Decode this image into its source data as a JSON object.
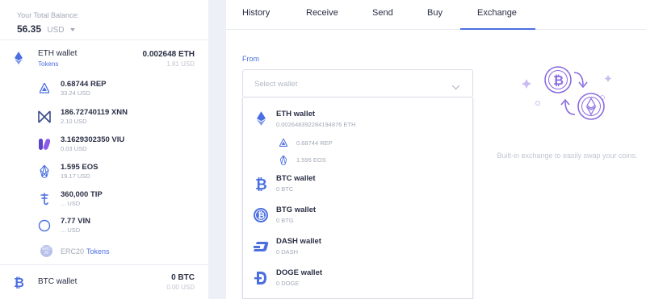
{
  "sidebar": {
    "balance_label": "Your Total Balance:",
    "balance_value": "56.35",
    "balance_currency": "USD",
    "eth_wallet": {
      "name": "ETH wallet",
      "sub": "Tokens",
      "amount": "0.002648 ETH",
      "usd": "1.81 USD",
      "icon": "ethereum-icon"
    },
    "tokens": [
      {
        "name": "0.68744 REP",
        "usd": "33.24 USD",
        "icon": "augur-rep-icon"
      },
      {
        "name": "186.72740119 XNN",
        "usd": "2.10 USD",
        "icon": "xenon-xnn-icon"
      },
      {
        "name": "3.1629302350 VIU",
        "usd": "0.03 USD",
        "icon": "viuly-viu-icon"
      },
      {
        "name": "1.595 EOS",
        "usd": "19.17 USD",
        "icon": "eos-icon"
      },
      {
        "name": "360,000 TIP",
        "usd": "... USD",
        "icon": "tip-icon"
      },
      {
        "name": "7.77 VIN",
        "usd": "... USD",
        "icon": "vin-icon"
      }
    ],
    "erc20": {
      "badge": "ERC 20",
      "label": "ERC20",
      "link": "Tokens"
    },
    "btc_wallet": {
      "name": "BTC wallet",
      "amount": "0 BTC",
      "usd": "0.00 USD",
      "icon": "bitcoin-icon"
    }
  },
  "tabs": [
    {
      "label": "History",
      "active": false
    },
    {
      "label": "Receive",
      "active": false
    },
    {
      "label": "Send",
      "active": false
    },
    {
      "label": "Buy",
      "active": false
    },
    {
      "label": "Exchange",
      "active": true
    }
  ],
  "exchange": {
    "from_label": "From",
    "select_placeholder": "Select wallet",
    "options": [
      {
        "name": "ETH wallet",
        "sub": "0.002648392284194876 ETH",
        "icon": "ethereum-icon"
      },
      {
        "name": "BTC wallet",
        "sub": "0 BTC",
        "icon": "bitcoin-icon"
      },
      {
        "name": "BTG wallet",
        "sub": "0 BTG",
        "icon": "bitcoin-gold-icon"
      },
      {
        "name": "DASH wallet",
        "sub": "0 DASH",
        "icon": "dash-icon"
      },
      {
        "name": "DOGE wallet",
        "sub": "0 DOGE",
        "icon": "dogecoin-icon"
      }
    ],
    "eth_tokens": [
      {
        "label": "0.68744 REP",
        "icon": "augur-rep-icon"
      },
      {
        "label": "1.595 EOS",
        "icon": "eos-icon"
      }
    ],
    "info_text": "Built-in exchange to easily swap your coins."
  },
  "colors": {
    "accent": "#4b6fe0",
    "illustration": "#8a6ce0",
    "sidebar_bg": "#ffffff",
    "app_bg": "#eef0f7"
  }
}
